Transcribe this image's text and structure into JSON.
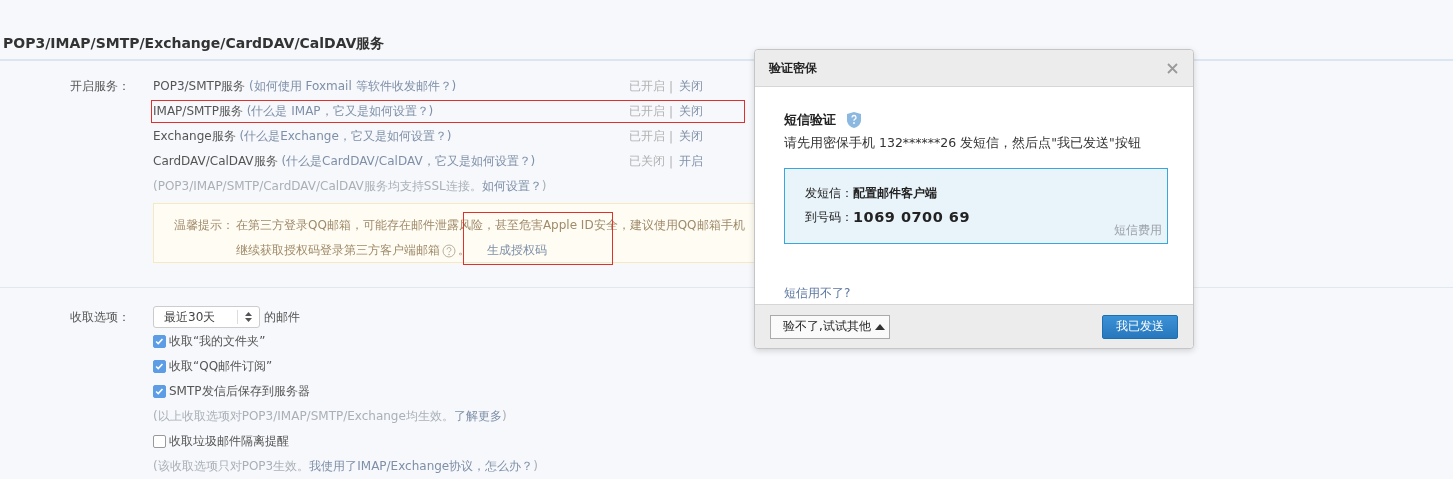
{
  "section": {
    "title": "POP3/IMAP/SMTP/Exchange/CardDAV/CalDAV服务"
  },
  "services": {
    "label": "开启服务：",
    "items": [
      {
        "name": "POP3/SMTP服务",
        "help": "(如何使用 Foxmail 等软件收发邮件？)",
        "status": "已开启",
        "separator": "|",
        "action": "关闭",
        "annotated": false
      },
      {
        "name": "IMAP/SMTP服务",
        "help": "(什么是 IMAP，它又是如何设置？)",
        "status": "已开启",
        "separator": "|",
        "action": "关闭",
        "annotated": true
      },
      {
        "name": "Exchange服务",
        "help": "(什么是Exchange，它又是如何设置？)",
        "status": "已开启",
        "separator": "|",
        "action": "关闭",
        "annotated": false
      },
      {
        "name": "CardDAV/CalDAV服务",
        "help": "(什么是CardDAV/CalDAV，它又是如何设置？)",
        "status": "已关闭",
        "separator": "|",
        "action": "开启",
        "annotated": false
      }
    ],
    "note": {
      "text": "(POP3/IMAP/SMTP/CardDAV/CalDAV服务均支持SSL连接。",
      "link": "如何设置？",
      "end": ")"
    }
  },
  "tip": {
    "label": "温馨提示：",
    "text": "在第三方登录QQ邮箱，可能存在邮件泄露风险，甚至危害Apple ID安全，建议使用QQ邮箱手机",
    "text2": "继续获取授权码登录第三方客户端邮箱",
    "after_icon": "。",
    "link": "生成授权码",
    "link_annotated": true
  },
  "fetch": {
    "label": "收取选项：",
    "select": "最近30天",
    "suffix": "的邮件",
    "items": [
      {
        "kind": "checkbox",
        "label": "收取“我的文件夹”",
        "checked": true
      },
      {
        "kind": "checkbox",
        "label": "收取“QQ邮件订阅”",
        "checked": true
      },
      {
        "kind": "checkbox",
        "label": "SMTP发信后保存到服务器",
        "checked": true
      },
      {
        "kind": "note",
        "text": "(以上收取选项对POP3/IMAP/SMTP/Exchange均生效。",
        "link": "了解更多",
        "end": ")"
      },
      {
        "kind": "checkbox",
        "label": "收取垃圾邮件隔离提醒",
        "checked": false
      },
      {
        "kind": "note",
        "text": "(该收取选项只对POP3生效。",
        "link": "我使用了IMAP/Exchange协议，怎么办？",
        "end": ")"
      }
    ]
  },
  "dialog": {
    "title": "验证密保",
    "heading": "短信验证",
    "instruction": "请先用密保手机 132******26 发短信，然后点\"我已发送\"按钮",
    "sms": [
      {
        "label": "发短信：",
        "value": "配置邮件客户端"
      },
      {
        "label": "到号码：",
        "value": "1069 0700 69"
      }
    ],
    "fee_link": "短信费用",
    "help_link": "短信用不了?",
    "alt_button": "验不了,试试其他",
    "send_button": "我已发送"
  }
}
